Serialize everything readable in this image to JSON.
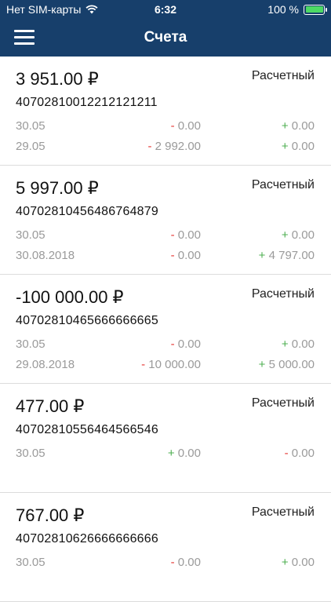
{
  "status_bar": {
    "carrier": "Нет SIM-карты",
    "time": "6:32",
    "battery": "100 %"
  },
  "header": {
    "title": "Счета"
  },
  "colors": {
    "header_bg": "#173f6b",
    "minus": "#e53935",
    "plus": "#4caf50",
    "muted": "#9a9a9a"
  },
  "accounts": [
    {
      "amount": "3 951.00 ₽",
      "type": "Расчетный",
      "number": "40702810012212121211",
      "rows": [
        {
          "date": "30.05",
          "debit_sign": "-",
          "debit": "0.00",
          "credit_sign": "+",
          "credit": "0.00"
        },
        {
          "date": "29.05",
          "debit_sign": "-",
          "debit": "2 992.00",
          "credit_sign": "+",
          "credit": "0.00"
        }
      ]
    },
    {
      "amount": "5 997.00 ₽",
      "type": "Расчетный",
      "number": "40702810456486764879",
      "rows": [
        {
          "date": "30.05",
          "debit_sign": "-",
          "debit": "0.00",
          "credit_sign": "+",
          "credit": "0.00"
        },
        {
          "date": "30.08.2018",
          "debit_sign": "-",
          "debit": "0.00",
          "credit_sign": "+",
          "credit": "4 797.00"
        }
      ]
    },
    {
      "amount": "-100 000.00 ₽",
      "type": "Расчетный",
      "number": "40702810465666666665",
      "rows": [
        {
          "date": "30.05",
          "debit_sign": "-",
          "debit": "0.00",
          "credit_sign": "+",
          "credit": "0.00"
        },
        {
          "date": "29.08.2018",
          "debit_sign": "-",
          "debit": "10 000.00",
          "credit_sign": "+",
          "credit": "5 000.00"
        }
      ]
    },
    {
      "amount": "477.00 ₽",
      "type": "Расчетный",
      "number": "40702810556464566546",
      "rows": [
        {
          "date": "30.05",
          "debit_sign": "+",
          "debit": "0.00",
          "credit_sign": "-",
          "credit": "0.00"
        }
      ]
    },
    {
      "amount": "767.00 ₽",
      "type": "Расчетный",
      "number": "40702810626666666666",
      "rows": [
        {
          "date": "30.05",
          "debit_sign": "-",
          "debit": "0.00",
          "credit_sign": "+",
          "credit": "0.00"
        }
      ]
    }
  ]
}
